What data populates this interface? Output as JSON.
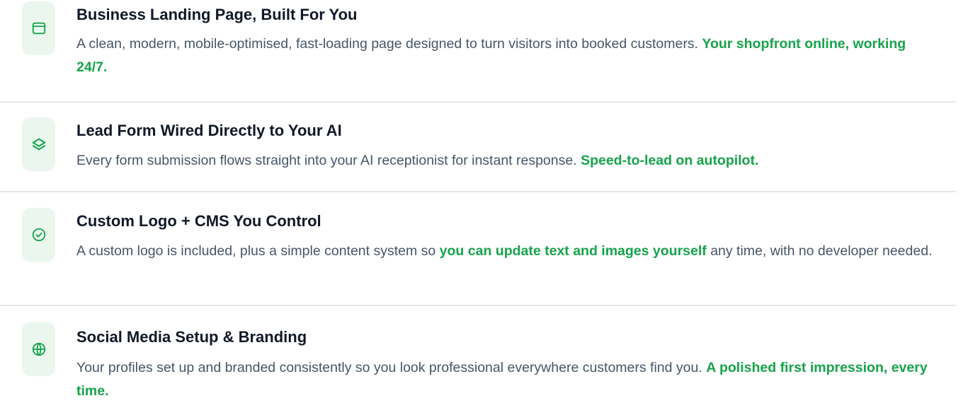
{
  "features": [
    {
      "icon": "browser-window-icon",
      "title": "Business Landing Page, Built For You",
      "desc_before": "A clean, modern, mobile-optimised, fast-loading page designed to turn visitors into booked customers. ",
      "desc_highlight": "Your shopfront online, working 24/7.",
      "desc_after": ""
    },
    {
      "icon": "layers-icon",
      "title": "Lead Form Wired Directly to Your AI",
      "desc_before": "Every form submission flows straight into your AI receptionist for instant response. ",
      "desc_highlight": "Speed-to-lead on autopilot.",
      "desc_after": ""
    },
    {
      "icon": "check-circle-icon",
      "title": "Custom Logo + CMS You Control",
      "desc_before": "A custom logo is included, plus a simple content system so ",
      "desc_highlight": "you can update text and images yourself",
      "desc_after": " any time, with no developer needed."
    },
    {
      "icon": "globe-icon",
      "title": "Social Media Setup & Branding",
      "desc_before": "Your profiles set up and branded consistently so you look professional everywhere customers find you. ",
      "desc_highlight": "A polished first impression, every time.",
      "desc_after": ""
    }
  ],
  "colors": {
    "accent": "#16a34a",
    "icon_bg": "#eaf6ee",
    "title": "#111827",
    "body": "#475569",
    "divider": "#e5e7eb"
  }
}
